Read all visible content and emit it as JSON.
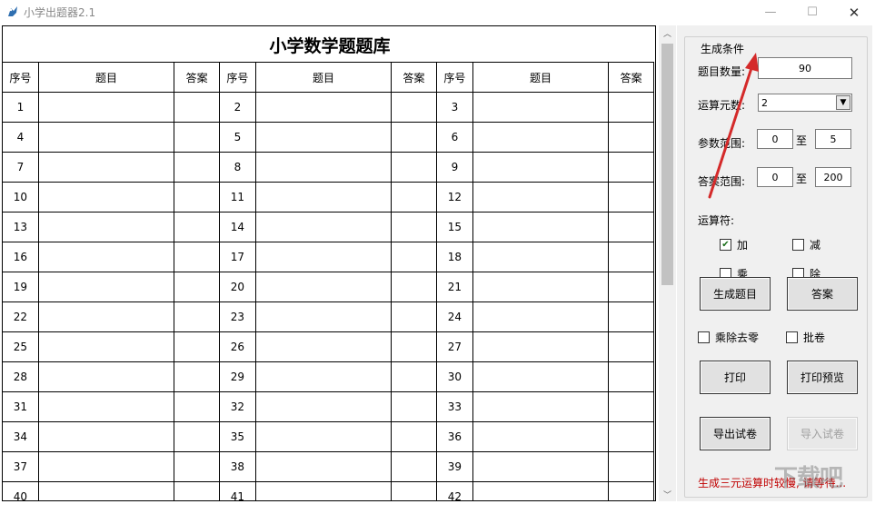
{
  "window": {
    "title": "小学出题器2.1",
    "controls": {
      "minimize": "—",
      "maximize": "☐",
      "close": "✕"
    }
  },
  "sheet": {
    "title": "小学数学题题库",
    "headers": [
      "序号",
      "题目",
      "答案",
      "序号",
      "题目",
      "答案",
      "序号",
      "题目",
      "答案"
    ],
    "rows": [
      [
        1,
        2,
        3
      ],
      [
        4,
        5,
        6
      ],
      [
        7,
        8,
        9
      ],
      [
        10,
        11,
        12
      ],
      [
        13,
        14,
        15
      ],
      [
        16,
        17,
        18
      ],
      [
        19,
        20,
        21
      ],
      [
        22,
        23,
        24
      ],
      [
        25,
        26,
        27
      ],
      [
        28,
        29,
        30
      ],
      [
        31,
        32,
        33
      ],
      [
        34,
        35,
        36
      ],
      [
        37,
        38,
        39
      ],
      [
        40,
        41,
        42
      ]
    ]
  },
  "panel": {
    "group_title": "生成条件",
    "count_label": "题目数量:",
    "count_value": "90",
    "operand_label": "运算元数:",
    "operand_value": "2",
    "param_label": "参数范围:",
    "param_min": "0",
    "param_to": "至",
    "param_max": "5",
    "answer_label": "答案范围:",
    "answer_min": "0",
    "answer_to": "至",
    "answer_max": "200",
    "operators_label": "运算符:",
    "op_add": "加",
    "op_sub": "减",
    "op_mul": "乘",
    "op_div": "除",
    "op_add_checked": true,
    "generate_button": "生成题目",
    "answer_button": "答案",
    "remove_zero": "乘除去零",
    "grade": "批卷",
    "print_button": "打印",
    "print_preview_button": "打印预览",
    "export_button": "导出试卷",
    "import_button": "导入试卷",
    "note": "生成三元运算时较慢, 请等待..."
  },
  "watermark": "下载吧",
  "colors": {
    "note": "#c00000",
    "arrow": "#d42a2a",
    "check": "#1a6e1a"
  }
}
